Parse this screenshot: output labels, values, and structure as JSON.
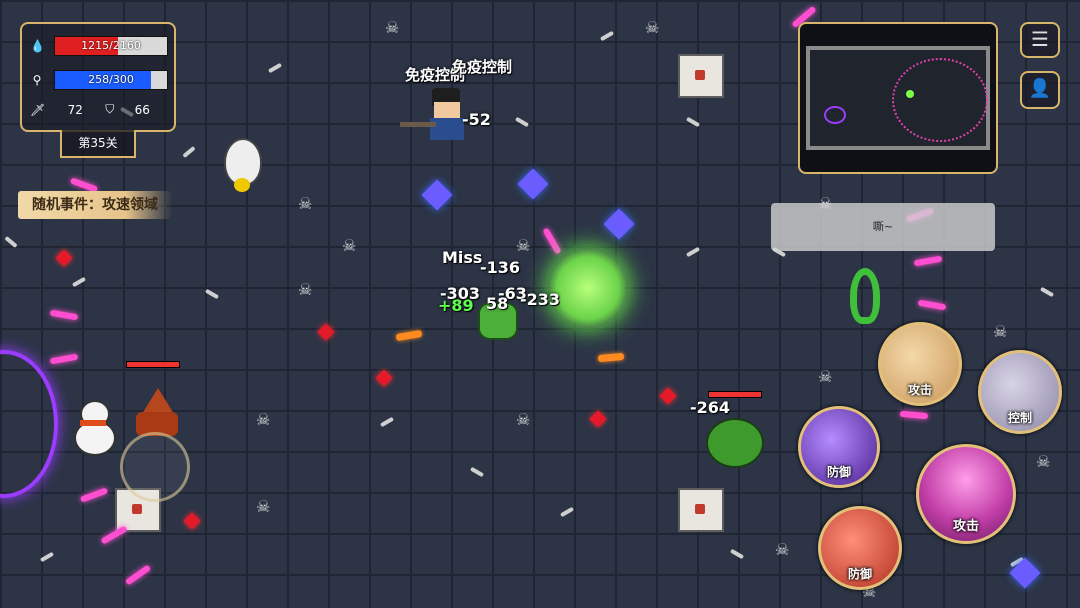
{
  "hud": {
    "hp_text": "1215/2160",
    "hp_fraction": 0.5625,
    "mp_text": "258/300",
    "mp_fraction": 0.86,
    "attack_value": "72",
    "defense_value": "66",
    "level_label": "第35关",
    "random_event": "随机事件：攻速领域",
    "colors": {
      "hp": "#e02020",
      "mp": "#1a5cff",
      "frame": "#d8b56a"
    }
  },
  "player": {
    "status_labels": [
      "免疫控制",
      "免疫控制"
    ]
  },
  "combat_text": {
    "player_dmg": "-52",
    "miss": "Miss",
    "d1": "-136",
    "d2": "-303",
    "d3": "-63",
    "heal": "+89",
    "d4": "58",
    "d5": "-233",
    "d6": "-264"
  },
  "enemy_speech": "嘶~",
  "skills": {
    "attack_a": "攻击",
    "control": "控制",
    "defend_a": "防御",
    "attack_b": "攻击",
    "defend_b": "防御"
  },
  "buttons": {
    "menu_icon": "menu-icon",
    "user_icon": "user-icon"
  }
}
